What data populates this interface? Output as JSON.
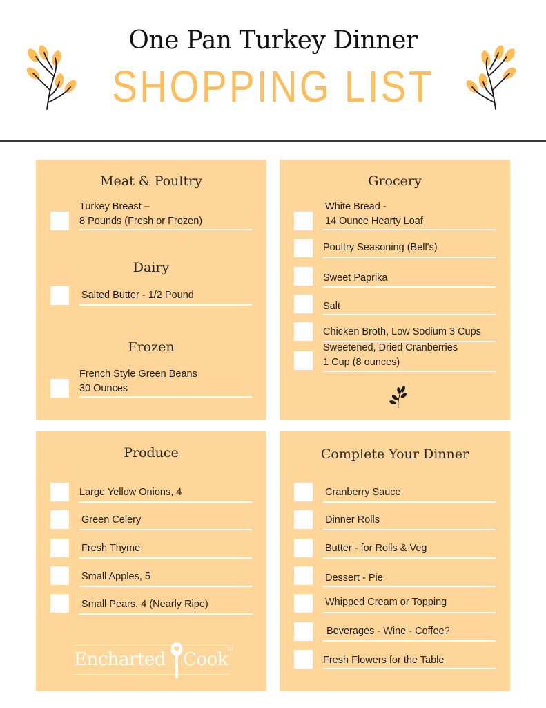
{
  "header": {
    "title": "One Pan Turkey Dinner",
    "subtitle": "SHOPPING LIST",
    "left_icon": "leaf-sprig-icon",
    "right_icon": "leaf-sprig-icon"
  },
  "colors": {
    "accent": "#ffbd5a",
    "panel": "#ffd699",
    "rule": "#3a3a3a",
    "text": "#1f1f1f"
  },
  "sections": {
    "meat": {
      "title": "Meat & Poultry",
      "items": [
        {
          "line1": "Turkey Breast –",
          "line2": "8 Pounds (Fresh or Frozen)"
        }
      ]
    },
    "dairy": {
      "title": "Dairy",
      "items": [
        {
          "line1": "Salted Butter - 1/2 Pound"
        }
      ]
    },
    "frozen": {
      "title": "Frozen",
      "items": [
        {
          "line1": "French Style Green Beans",
          "line2": "30 Ounces"
        }
      ]
    },
    "grocery": {
      "title": "Grocery",
      "items": [
        {
          "line1": "White Bread -",
          "line2": "14 Ounce Hearty Loaf"
        },
        {
          "line1": "Poultry Seasoning (Bell's)"
        },
        {
          "line1": "Sweet Paprika"
        },
        {
          "line1": "Salt"
        },
        {
          "line1": "Chicken Broth, Low Sodium 3 Cups"
        },
        {
          "line1": "Sweetened, Dried Cranberries",
          "line2": "1 Cup (8 ounces)"
        }
      ],
      "footer_icon": "leaf-sprig-icon"
    },
    "produce": {
      "title": "Produce",
      "items": [
        {
          "line1": "Large Yellow Onions, 4"
        },
        {
          "line1": "Green Celery"
        },
        {
          "line1": "Fresh Thyme"
        },
        {
          "line1": "Small Apples, 5"
        },
        {
          "line1": "Small Pears, 4 (Nearly Ripe)"
        }
      ]
    },
    "complete": {
      "title": "Complete Your Dinner",
      "items": [
        {
          "line1": "Cranberry Sauce"
        },
        {
          "line1": "Dinner Rolls"
        },
        {
          "line1": "Butter - for Rolls & Veg"
        },
        {
          "line1": "Dessert - Pie"
        },
        {
          "line1": "Whipped Cream or Topping"
        },
        {
          "line1": "Beverages - Wine - Coffee?"
        },
        {
          "line1": "Fresh Flowers for the Table"
        }
      ]
    }
  },
  "logo": {
    "left": "Encharted",
    "right": "Cook",
    "tm": "TM",
    "icon": "spoon-heart-icon"
  }
}
